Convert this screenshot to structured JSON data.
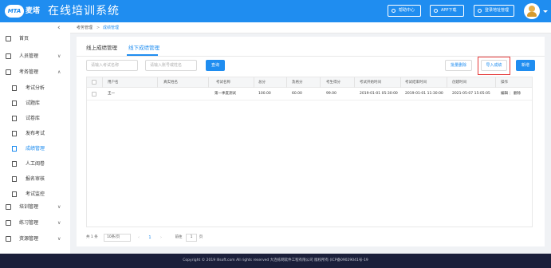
{
  "header": {
    "logo_badge": "MTA",
    "logo_text": "麦塔",
    "title": "在线培训系统",
    "buttons": [
      {
        "label": "帮助中心",
        "icon": "help-icon"
      },
      {
        "label": "APP下载",
        "icon": "download-icon"
      },
      {
        "label": "登录地址管理",
        "icon": "location-icon"
      }
    ],
    "colors": {
      "primary": "#1f8df0",
      "footer": "#1b1f3a",
      "highlight": "#e63b3b"
    }
  },
  "sidebar": {
    "collapse_icon": "‹",
    "items": [
      {
        "label": "首页",
        "icon": "home-icon"
      },
      {
        "label": "人员管理",
        "icon": "user-icon",
        "arrow": "∨"
      },
      {
        "label": "考务管理",
        "icon": "exam-icon",
        "arrow": "∧"
      }
    ],
    "subitems": [
      {
        "label": "考试分析",
        "icon": "analysis-icon"
      },
      {
        "label": "试题库",
        "icon": "question-bank-icon"
      },
      {
        "label": "试卷库",
        "icon": "paper-bank-icon"
      },
      {
        "label": "发布考试",
        "icon": "publish-icon"
      },
      {
        "label": "成绩管理",
        "icon": "score-icon",
        "active": true
      },
      {
        "label": "人工阅卷",
        "icon": "grading-icon"
      },
      {
        "label": "报名审核",
        "icon": "signup-icon"
      },
      {
        "label": "考试监控",
        "icon": "monitor-icon"
      }
    ],
    "bottom_items": [
      {
        "label": "培训管理",
        "icon": "training-icon",
        "arrow": "∨"
      },
      {
        "label": "练习管理",
        "icon": "practice-icon",
        "arrow": "∨"
      },
      {
        "label": "资源管理",
        "icon": "resource-icon",
        "arrow": "∨"
      }
    ]
  },
  "breadcrumb": {
    "parent": "考务管理",
    "separator": ">",
    "current": "成绩管理"
  },
  "tabs": [
    {
      "label": "线上成绩管理",
      "active": false
    },
    {
      "label": "线下成绩管理",
      "active": true
    }
  ],
  "filters": {
    "exam_name_placeholder": "请输入考试名称",
    "user_placeholder": "请输入账号或姓名",
    "search_label": "查询",
    "batch_delete_label": "批量删除",
    "import_label": "导入成绩",
    "add_label": "新增"
  },
  "table": {
    "columns": [
      "用户名",
      "真实姓名",
      "考试名称",
      "总分",
      "及格分",
      "考生得分",
      "考试开始时间",
      "考试结束时间",
      "创建时间",
      "操作"
    ],
    "rows": [
      {
        "username": "王一",
        "realname": "",
        "exam": "第一季度测试",
        "total": "100.00",
        "pass": "60.00",
        "score": "99.00",
        "start": "2019-01-01 05:30:00",
        "end": "2019-01-01 11:30:00",
        "created": "2021-05-07 15:05:05",
        "edit": "编辑",
        "sep": "|",
        "delete": "删除"
      }
    ]
  },
  "pagination": {
    "total": "共 1 条",
    "page_size": "10条/页",
    "prev": "‹",
    "current": "1",
    "next": "›",
    "goto_prefix": "前往",
    "goto_value": "1",
    "goto_suffix": "页"
  },
  "footer": {
    "text": "Copyright © 2019 lllsoft.com All rights reserved 大连栋网软件工程有限公司 版权所有 (ICP备09029041号-19"
  }
}
